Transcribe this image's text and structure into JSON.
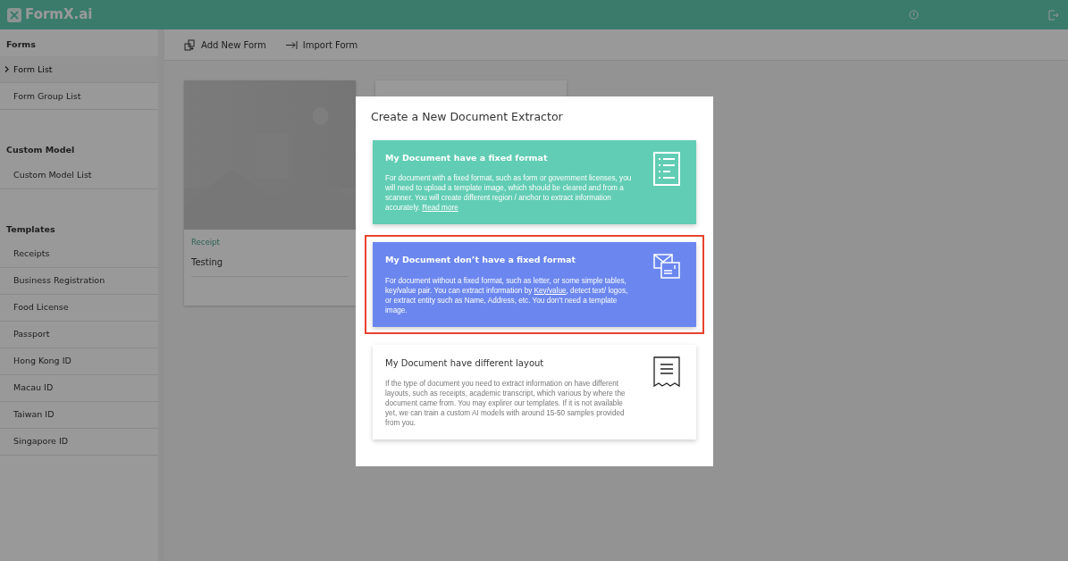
{
  "header": {
    "logo": "FormX.ai"
  },
  "sidebar": {
    "sections": [
      {
        "title": "Forms",
        "items": [
          {
            "label": "Form List",
            "selected": true
          },
          {
            "label": "Form Group List",
            "selected": false
          }
        ]
      },
      {
        "title": "Custom Model",
        "items": [
          {
            "label": "Custom Model List",
            "selected": false
          }
        ]
      },
      {
        "title": "Templates",
        "items": [
          {
            "label": "Receipts",
            "selected": false
          },
          {
            "label": "Business Registration",
            "selected": false
          },
          {
            "label": "Food License",
            "selected": false
          },
          {
            "label": "Passport",
            "selected": false
          },
          {
            "label": "Hong Kong ID",
            "selected": false
          },
          {
            "label": "Macau ID",
            "selected": false
          },
          {
            "label": "Taiwan ID",
            "selected": false
          },
          {
            "label": "Singapore ID",
            "selected": false
          }
        ]
      }
    ]
  },
  "toolbar": [
    {
      "kind": "add",
      "label": "Add New Form"
    },
    {
      "kind": "import",
      "label": "Import Form"
    }
  ],
  "forms": [
    {
      "kind": "picture",
      "tag": "Receipt",
      "title": "Testing"
    },
    {
      "kind": "plain"
    }
  ],
  "dialog": {
    "title": "Create a New Document Extractor",
    "options": [
      {
        "kind": "fixed",
        "color": "#61cdb4",
        "selected": false,
        "title": "My Document have a fixed format",
        "text": "For document with a fixed format, such as form or government licenses, you will need to upload a template image, which should be cleared and from a scanner. You will create different region / anchor to extract information accurately. ",
        "link": "Read more"
      },
      {
        "kind": "free",
        "color": "#6b87ef",
        "selected": true,
        "title": "My Document don’t have a fixed format",
        "text": "For document without a fixed format, such as letter, or some simple tables, key/value pair. You can extract information by ",
        "link": "Key/value",
        "text_after": ", detect text/ logos, or extract entity such as Name, Address, etc. You don’t need a template image."
      },
      {
        "kind": "layout",
        "color": "#ffffff",
        "selected": false,
        "title": "My Document have different layout",
        "text": "If the type of document you need to extract information on have different layouts, such as receipts, academic transcript, which various by where the document came from. You may explirer our templates. If it is not available yet, we can train a custom AI models with around 15-50 samples provided from you."
      }
    ]
  }
}
